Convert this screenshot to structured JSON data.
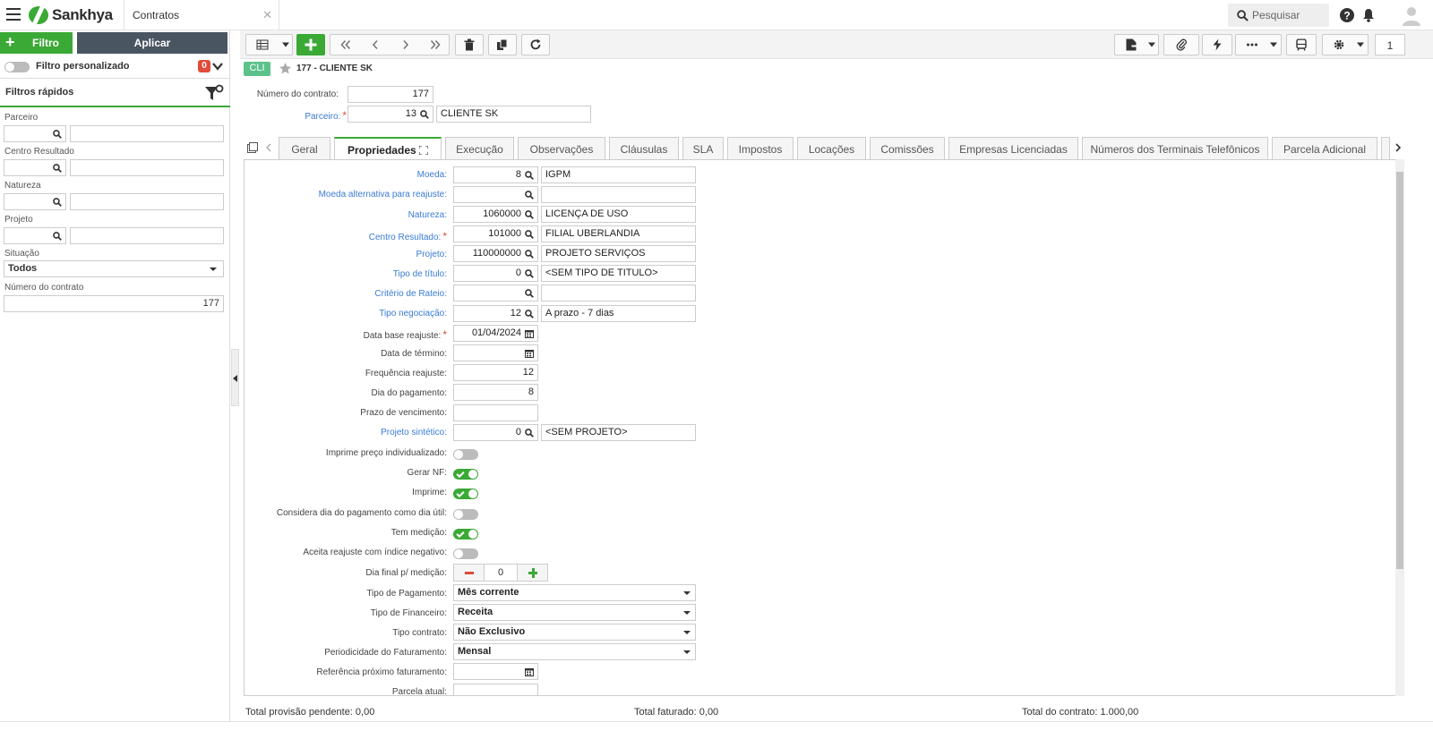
{
  "app": {
    "brand": "Sankhya",
    "tab_title": "Contratos",
    "search_placeholder": "Pesquisar",
    "accent": "#3aa935"
  },
  "filter_panel": {
    "filtro_label": "Filtro",
    "aplicar_label": "Aplicar",
    "custom_filter_label": "Filtro personalizado",
    "custom_filter_count": "0",
    "quick_filters_title": "Filtros rápidos",
    "fields": {
      "parceiro": "Parceiro",
      "centro_resultado": "Centro Resultado",
      "natureza": "Natureza",
      "projeto": "Projeto",
      "situacao": "Situação",
      "situacao_value": "Todos",
      "numero_contrato": "Número do contrato",
      "numero_contrato_value": "177"
    }
  },
  "toolbar": {
    "page_number": "1"
  },
  "record": {
    "badge": "CLI",
    "title": "177 - CLIENTE SK"
  },
  "header_form": {
    "numero_label": "Número do contrato:",
    "numero_value": "177",
    "parceiro_label": "Parceiro:",
    "parceiro_code": "13",
    "parceiro_name": "CLIENTE SK"
  },
  "tabs": [
    "Geral",
    "Propriedades",
    "Execução",
    "Observações",
    "Cláusulas",
    "SLA",
    "Impostos",
    "Locações",
    "Comissões",
    "Empresas Licenciadas",
    "Números dos Terminais Telefônicos",
    "Parcela Adicional"
  ],
  "props": {
    "moeda": {
      "label": "Moeda:",
      "code": "8",
      "desc": "IGPM"
    },
    "moeda_alt": {
      "label": "Moeda alternativa para reajuste:",
      "code": "",
      "desc": ""
    },
    "natureza": {
      "label": "Natureza:",
      "code": "1060000",
      "desc": "LICENÇA DE USO"
    },
    "centro": {
      "label": "Centro Resultado:",
      "code": "101000",
      "desc": "FILIAL UBERLANDIA"
    },
    "projeto": {
      "label": "Projeto:",
      "code": "110000000",
      "desc": "PROJETO SERVIÇOS"
    },
    "tipo_titulo": {
      "label": "Tipo de título:",
      "code": "0",
      "desc": "<SEM TIPO DE TITULO>"
    },
    "criterio": {
      "label": "Critério de Rateio:",
      "code": "",
      "desc": ""
    },
    "tipo_neg": {
      "label": "Tipo negociação:",
      "code": "12",
      "desc": "A prazo - 7 dias"
    },
    "data_base": {
      "label": "Data base reajuste:",
      "value": "01/04/2024"
    },
    "data_termino": {
      "label": "Data de término:",
      "value": ""
    },
    "frequencia": {
      "label": "Frequência reajuste:",
      "value": "12"
    },
    "dia_pag": {
      "label": "Dia do pagamento:",
      "value": "8"
    },
    "prazo": {
      "label": "Prazo de vencimento:",
      "value": ""
    },
    "projeto_sint": {
      "label": "Projeto sintético:",
      "code": "0",
      "desc": "<SEM PROJETO>"
    },
    "imprime_preco": {
      "label": "Imprime preço individualizado:",
      "on": false
    },
    "gerar_nf": {
      "label": "Gerar NF:",
      "on": true
    },
    "imprime": {
      "label": "Imprime:",
      "on": true
    },
    "considera_dia": {
      "label": "Considera dia do pagamento como dia útil:",
      "on": false
    },
    "tem_medicao": {
      "label": "Tem medição:",
      "on": true
    },
    "aceita_reajuste": {
      "label": "Aceita reajuste com índice negativo:",
      "on": false
    },
    "dia_final": {
      "label": "Dia final p/ medição:",
      "value": "0"
    },
    "tipo_pag": {
      "label": "Tipo de Pagamento:",
      "value": "Mês corrente"
    },
    "tipo_fin": {
      "label": "Tipo de Financeiro:",
      "value": "Receita"
    },
    "tipo_contrato": {
      "label": "Tipo contrato:",
      "value": "Não Exclusivo"
    },
    "periodicidade": {
      "label": "Periodicidade do Faturamento:",
      "value": "Mensal"
    },
    "referencia": {
      "label": "Referência próximo faturamento:",
      "value": ""
    },
    "parcela_atual": {
      "label": "Parcela atual:",
      "value": ""
    }
  },
  "footer": {
    "provisao": "Total provisão pendente: 0,00",
    "faturado": "Total faturado: 0,00",
    "contrato": "Total do contrato: 1.000,00"
  }
}
